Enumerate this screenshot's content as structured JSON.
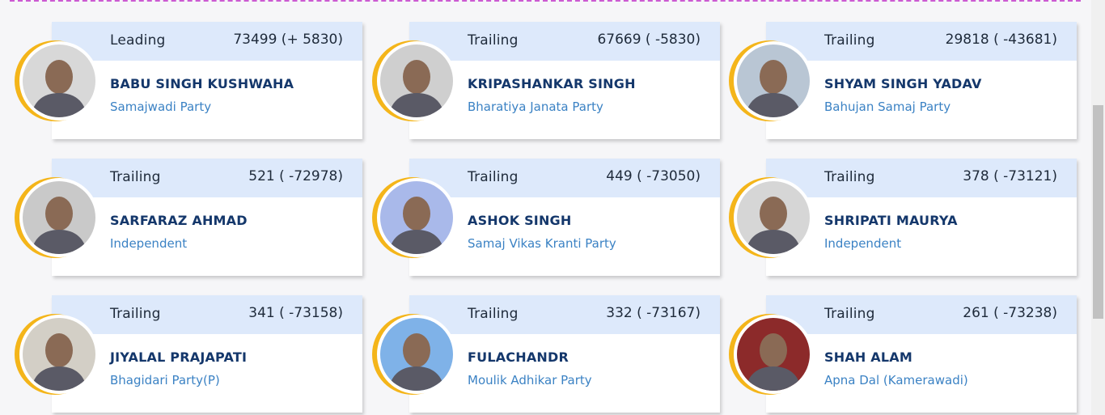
{
  "candidates": [
    {
      "status": "Leading",
      "votes": "73499 (+ 5830)",
      "name": "BABU SINGH KUSHWAHA",
      "party": "Samajwadi Party",
      "photo_bg": "#d8d8d8"
    },
    {
      "status": "Trailing",
      "votes": "67669 ( -5830)",
      "name": "KRIPASHANKAR SINGH",
      "party": "Bharatiya Janata Party",
      "photo_bg": "#cfcfcf"
    },
    {
      "status": "Trailing",
      "votes": "29818 ( -43681)",
      "name": "SHYAM SINGH YADAV",
      "party": "Bahujan Samaj Party",
      "photo_bg": "#b9c6d4"
    },
    {
      "status": "Trailing",
      "votes": "521 ( -72978)",
      "name": "SARFARAZ AHMAD",
      "party": "Independent",
      "photo_bg": "#c9c9c9"
    },
    {
      "status": "Trailing",
      "votes": "449 ( -73050)",
      "name": "ASHOK SINGH",
      "party": "Samaj Vikas Kranti Party",
      "photo_bg": "#a9b9ea"
    },
    {
      "status": "Trailing",
      "votes": "378 ( -73121)",
      "name": "SHRIPATI MAURYA",
      "party": "Independent",
      "photo_bg": "#d6d6d6"
    },
    {
      "status": "Trailing",
      "votes": "341 ( -73158)",
      "name": "JIYALAL PRAJAPATI",
      "party": "Bhagidari Party(P)",
      "photo_bg": "#d3cfc6"
    },
    {
      "status": "Trailing",
      "votes": "332 ( -73167)",
      "name": "FULACHANDR",
      "party": "Moulik Adhikar Party",
      "photo_bg": "#7fb2e8"
    },
    {
      "status": "Trailing",
      "votes": "261 ( -73238)",
      "name": "SHAH ALAM",
      "party": "Apna Dal (Kamerawadi)",
      "photo_bg": "#8c2a2a"
    }
  ],
  "colors": {
    "header_bg": "#dde9fb",
    "name": "#14376b",
    "party": "#3b82c4",
    "ring": "#f4b51a",
    "dashed_rule": "#cc5ad2"
  }
}
